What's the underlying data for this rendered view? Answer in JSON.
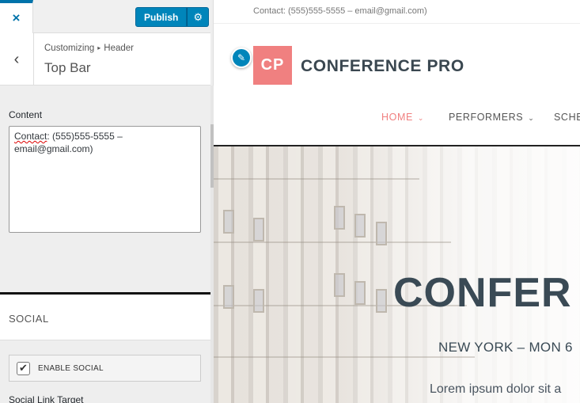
{
  "customizer": {
    "close_icon": "×",
    "publish_label": "Publish",
    "settings_icon": "⚙",
    "back_icon": "‹",
    "breadcrumb": {
      "root": "Customizing",
      "separator": "▸",
      "parent": "Header"
    },
    "section_title": "Top Bar",
    "content_label": "Content",
    "content_value_spellword": "Contact",
    "content_value_rest": ": (555)555-5555 – email@gmail.com)",
    "social_section_title": "SOCIAL",
    "enable_social": {
      "label": "ENABLE SOCIAL",
      "checked": true,
      "check_icon": "✔"
    },
    "social_link_target_label": "Social Link Target"
  },
  "preview": {
    "topbar_text": "Contact: (555)555-5555 – email@gmail.com)",
    "edit_icon": "✎",
    "logo_mark": "CP",
    "logo_text": "CONFERENCE PRO",
    "nav": [
      {
        "label": "HOME",
        "chevron": "⌄",
        "active": true
      },
      {
        "label": "PERFORMERS",
        "chevron": "⌄",
        "active": false
      },
      {
        "label": "SCHE",
        "chevron": "",
        "active": false
      }
    ],
    "hero": {
      "title": "CONFER",
      "subtitle": "NEW YORK – MON 6",
      "lorem": "Lorem ipsum dolor sit a"
    }
  },
  "colors": {
    "wp_blue": "#0085ba",
    "accent_pink": "#f08080",
    "heading_dark": "#3a4a55"
  }
}
